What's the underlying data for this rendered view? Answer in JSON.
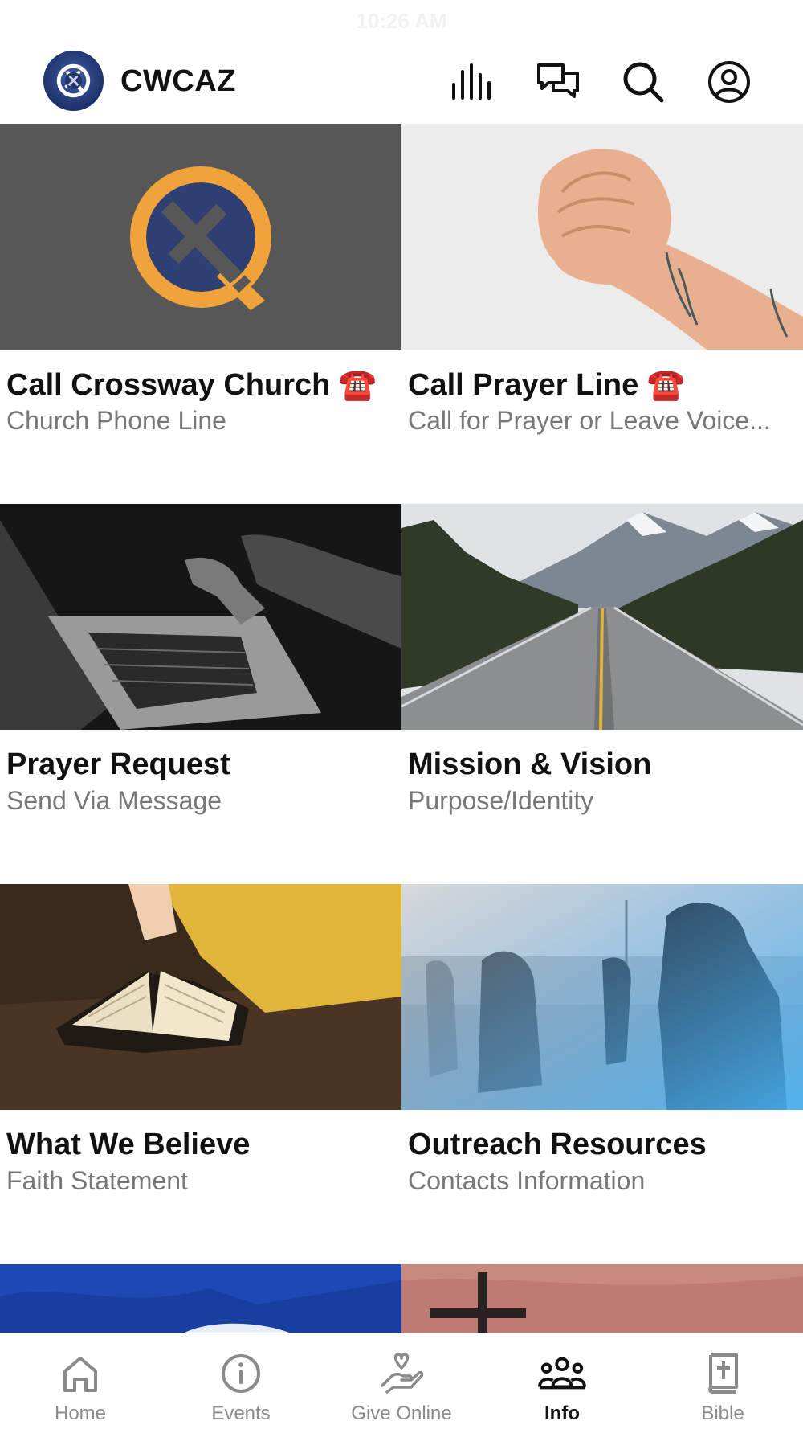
{
  "status_bar": {
    "time": "10:26 AM"
  },
  "header": {
    "title": "CWCAZ"
  },
  "tiles": [
    {
      "title": "Call Crossway Church ☎️",
      "subtitle": "Church Phone Line"
    },
    {
      "title": "Call Prayer Line ☎️",
      "subtitle": "Call for Prayer or Leave Voice..."
    },
    {
      "title": "Prayer Request",
      "subtitle": "Send Via Message"
    },
    {
      "title": "Mission & Vision",
      "subtitle": "Purpose/Identity"
    },
    {
      "title": "What We Believe",
      "subtitle": "Faith Statement"
    },
    {
      "title": "Outreach Resources",
      "subtitle": "Contacts Information"
    }
  ],
  "tabbar": {
    "items": [
      {
        "label": "Home",
        "icon": "home-icon"
      },
      {
        "label": "Events",
        "icon": "info-circle-icon"
      },
      {
        "label": "Give Online",
        "icon": "give-hand-heart-icon"
      },
      {
        "label": "Info",
        "icon": "people-group-icon",
        "active": true
      },
      {
        "label": "Bible",
        "icon": "bible-icon"
      }
    ]
  },
  "colors": {
    "brand_orange": "#f0a33a",
    "brand_navy": "#2d3f73",
    "tile_gray": "#575757",
    "active_tab": "#111111",
    "inactive_tab": "#8a8a8a"
  }
}
